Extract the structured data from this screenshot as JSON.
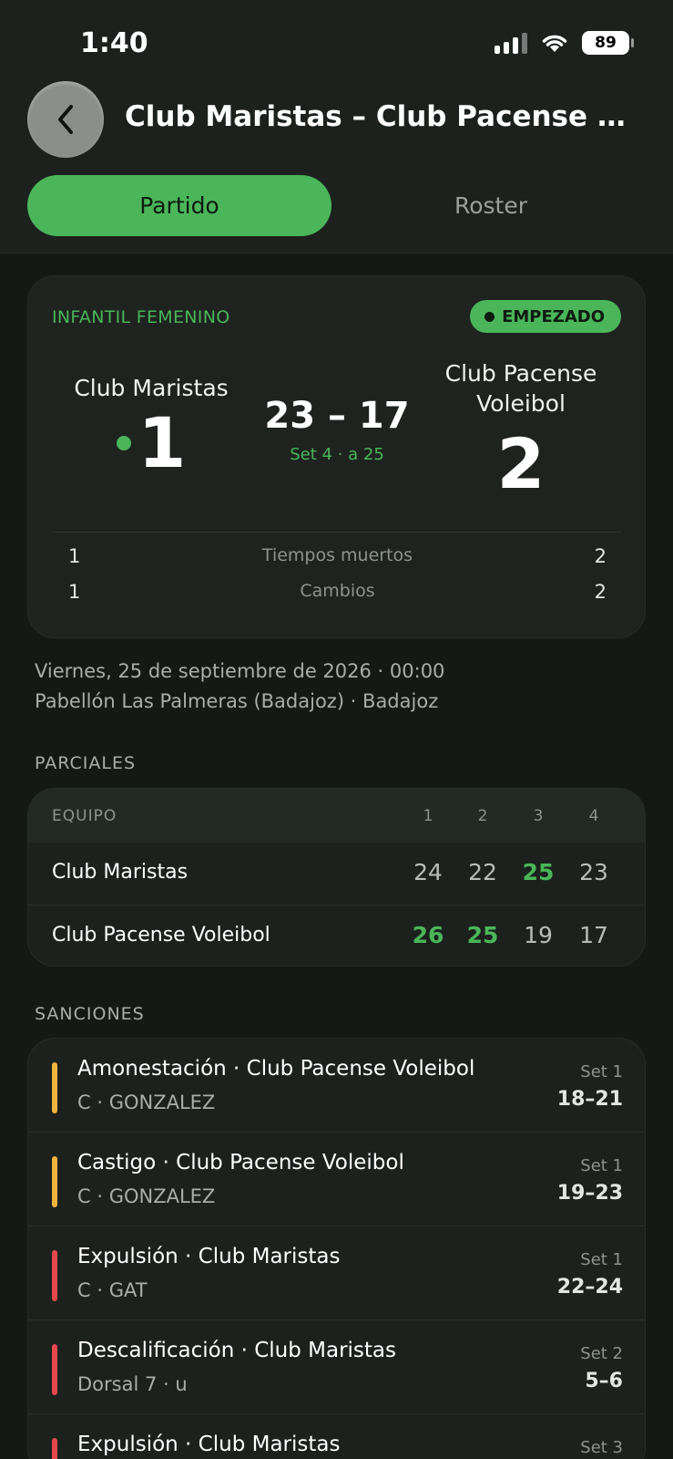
{
  "status_bar": {
    "time": "1:40",
    "battery": "89"
  },
  "header": {
    "title": "Club Maristas – Club Pacense Volei…",
    "tabs": [
      {
        "label": "Partido",
        "active": true
      },
      {
        "label": "Roster",
        "active": false
      }
    ]
  },
  "match": {
    "category": "INFANTIL FEMENINO",
    "status": "EMPEZADO",
    "home_team": "Club Maristas",
    "away_team": "Club Pacense Voleibol",
    "home_sets": "1",
    "away_sets": "2",
    "current_score": "23 – 17",
    "set_info": "Set 4 · a 25",
    "stats": [
      {
        "label": "Tiempos muertos",
        "home": "1",
        "away": "2"
      },
      {
        "label": "Cambios",
        "home": "1",
        "away": "2"
      }
    ]
  },
  "details": {
    "datetime": "Viernes, 25 de septiembre de 2026 · 00:00",
    "venue": "Pabellón Las Palmeras (Badajoz) · Badajoz"
  },
  "partials": {
    "section_label": "PARCIALES",
    "team_header": "EQUIPO",
    "set_headers": [
      "1",
      "2",
      "3",
      "4"
    ],
    "rows": [
      {
        "team": "Club Maristas",
        "scores": [
          "24",
          "22",
          "25",
          "23"
        ],
        "wins": [
          false,
          false,
          true,
          false
        ]
      },
      {
        "team": "Club Pacense Voleibol",
        "scores": [
          "26",
          "25",
          "19",
          "17"
        ],
        "wins": [
          true,
          true,
          false,
          false
        ]
      }
    ]
  },
  "sanctions": {
    "section_label": "SANCIONES",
    "items": [
      {
        "title": "Amonestación · Club Pacense Voleibol",
        "subtitle": "C · GONZALEZ",
        "set": "Set 1",
        "score": "18–21",
        "color": "#f2b43c"
      },
      {
        "title": "Castigo · Club Pacense Voleibol",
        "subtitle": "C · GONZALEZ",
        "set": "Set 1",
        "score": "19–23",
        "color": "#f2b43c"
      },
      {
        "title": "Expulsión · Club Maristas",
        "subtitle": "C · GAT",
        "set": "Set 1",
        "score": "22–24",
        "color": "#e5484d"
      },
      {
        "title": "Descalificación · Club Maristas",
        "subtitle": "Dorsal 7 · u",
        "set": "Set 2",
        "score": "5–6",
        "color": "#e5484d"
      },
      {
        "title": "Expulsión · Club Maristas",
        "subtitle": "",
        "set": "Set 3",
        "score": "",
        "color": "#e5484d"
      }
    ]
  },
  "colors": {
    "accent": "#4ab659",
    "warning": "#f2b43c",
    "danger": "#e5484d",
    "background": "#141916"
  }
}
